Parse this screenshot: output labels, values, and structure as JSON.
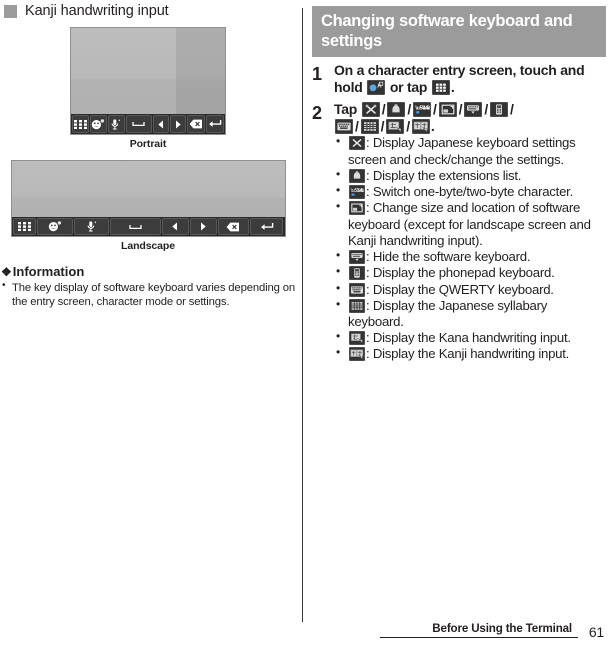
{
  "left": {
    "section_title": "Kanji handwriting input",
    "figures": [
      {
        "caption": "Portrait",
        "orientation": "portrait"
      },
      {
        "caption": "Landscape",
        "orientation": "landscape"
      }
    ],
    "keyboard_toolbar_keys": [
      "grid-icon",
      "emoji-icon",
      "microphone-icon",
      "space-icon",
      "arrow-left-icon",
      "arrow-right-icon",
      "backspace-icon",
      "enter-icon"
    ],
    "information": {
      "heading": "Information",
      "heading_marker": "❖",
      "items": [
        "The key display of software keyboard varies depending on the entry screen, character mode or settings."
      ]
    }
  },
  "right": {
    "heading": "Changing software keyboard and settings",
    "steps": [
      {
        "number": "1",
        "text_parts": [
          "On a character entry screen, touch and hold ",
          " or tap ",
          "."
        ],
        "icons": [
          "input-method-icon",
          "grid-icon"
        ]
      },
      {
        "number": "2",
        "lead_prefix": "Tap ",
        "lead_suffix": ".",
        "lead_separator": "/",
        "icons": [
          "settings-tools-icon",
          "extensions-icon",
          "one-byte-two-byte-icon",
          "resize-keyboard-icon",
          "hide-keyboard-icon",
          "phonepad-keyboard-icon",
          "qwerty-keyboard-icon",
          "syllabary-keyboard-icon",
          "kana-handwriting-icon",
          "kanji-handwriting-icon"
        ],
        "bullets": [
          {
            "icon": "settings-tools-icon",
            "text": ": Display Japanese keyboard settings screen and check/change the settings."
          },
          {
            "icon": "extensions-icon",
            "text": ": Display the extensions list."
          },
          {
            "icon": "one-byte-two-byte-icon",
            "text": ": Switch one-byte/two-byte character."
          },
          {
            "icon": "resize-keyboard-icon",
            "text": ": Change size and location of software keyboard (except for landscape screen and Kanji handwriting input)."
          },
          {
            "icon": "hide-keyboard-icon",
            "text": ": Hide the software keyboard."
          },
          {
            "icon": "phonepad-keyboard-icon",
            "text": ": Display the phonepad keyboard."
          },
          {
            "icon": "qwerty-keyboard-icon",
            "text": ": Display the QWERTY keyboard."
          },
          {
            "icon": "syllabary-keyboard-icon",
            "text": ": Display the Japanese syllabary keyboard."
          },
          {
            "icon": "kana-handwriting-icon",
            "text": ": Display the Kana handwriting input."
          },
          {
            "icon": "kanji-handwriting-icon",
            "text": ": Display the Kanji handwriting input."
          }
        ]
      }
    ]
  },
  "footer": {
    "chapter": "Before Using the Terminal",
    "page_number": "61"
  },
  "colors": {
    "band_gray": "#9b9b9b",
    "text": "#231f20",
    "keyboard_dark": "#2b2b2b",
    "keyboard_panel": "#b6b6b6",
    "chip_dark": "#333333"
  }
}
